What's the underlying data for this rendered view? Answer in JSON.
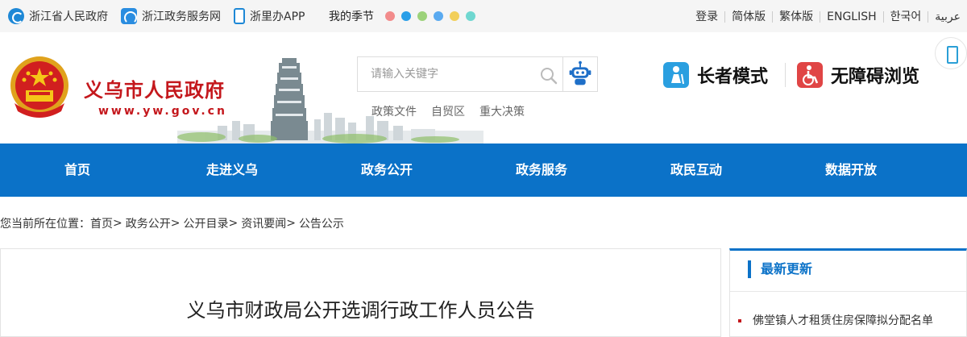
{
  "topbar": {
    "links": [
      {
        "label": "浙江省人民政府",
        "icon": "zhejiang-gov-icon"
      },
      {
        "label": "浙江政务服务网",
        "icon": "zhengwu-service-icon"
      },
      {
        "label": "浙里办APP",
        "icon": "mobile-app-icon"
      }
    ],
    "season_label": "我的季节",
    "season_colors": [
      "#f28b8b",
      "#2a9fe8",
      "#9cd27a",
      "#5aaaf0",
      "#f2cf5a",
      "#6fd7d0"
    ],
    "languages": [
      "登录",
      "简体版",
      "繁体版",
      "ENGLISH",
      "한국어",
      "عربية"
    ]
  },
  "header": {
    "site_name": "义乌市人民政府",
    "site_url": "www.yw.gov.cn",
    "search_placeholder": "请输入关键字",
    "hot_words": [
      "政策文件",
      "自贸区",
      "重大决策"
    ],
    "elder_mode": "长者模式",
    "accessible_mode": "无障碍浏览"
  },
  "nav": {
    "items": [
      "首页",
      "走进义乌",
      "政务公开",
      "政务服务",
      "政民互动",
      "数据开放"
    ]
  },
  "breadcrumb": {
    "prefix": "您当前所在位置：",
    "items": [
      "首页",
      "政务公开",
      "公开目录",
      "资讯要闻",
      "公告公示"
    ],
    "separator": ">"
  },
  "article": {
    "title": "义乌市财政局公开选调行政工作人员公告"
  },
  "sidebar": {
    "title": "最新更新",
    "items": [
      "佛堂镇人才租赁住房保障拟分配名单"
    ]
  },
  "colors": {
    "brand_red": "#c4171c",
    "nav_blue": "#0b72c8",
    "topbar_bg": "#f5f5f5"
  }
}
